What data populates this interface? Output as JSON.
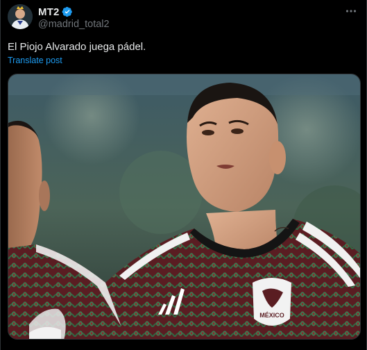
{
  "author": {
    "display_name": "MT2",
    "handle": "@madrid_total2",
    "verified": true,
    "avatar_icon": "avatar-icon"
  },
  "post": {
    "text": "El Piojo Alvarado juega pádel.",
    "translate_label": "Translate post"
  },
  "media": {
    "jersey_text": "MÉXICO"
  },
  "colors": {
    "background": "#000000",
    "text_primary": "#e7e9ea",
    "text_secondary": "#71767b",
    "accent": "#1d9bf0"
  },
  "icons": {
    "more": "more-options-icon",
    "verified": "verified-badge-icon"
  }
}
